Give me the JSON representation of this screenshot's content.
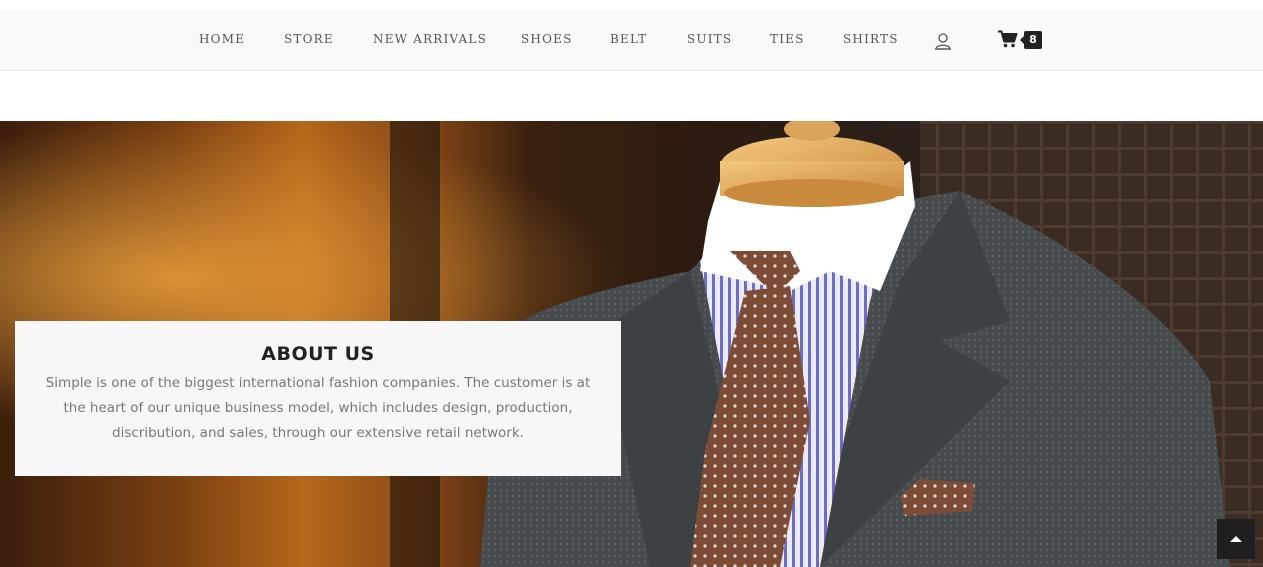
{
  "nav": {
    "items": [
      {
        "label": "HOME"
      },
      {
        "label": "STORE"
      },
      {
        "label": "NEW ARRIVALS"
      },
      {
        "label": "SHOES"
      },
      {
        "label": "BELT"
      },
      {
        "label": "SUITS"
      },
      {
        "label": "TIES"
      },
      {
        "label": "SHIRTS"
      }
    ],
    "user_icon": "user-icon",
    "cart_icon": "shopping-cart-icon",
    "cart_count": "8"
  },
  "hero": {
    "image": "suit-mannequin-photo"
  },
  "about": {
    "title": "ABOUT US",
    "text": "Simple is one of the biggest international fashion companies. The customer is at the heart of our unique business model, which includes design, production, discribution, and sales, through our extensive retail network."
  },
  "scroll_top": {
    "icon": "chevron-up-icon"
  }
}
